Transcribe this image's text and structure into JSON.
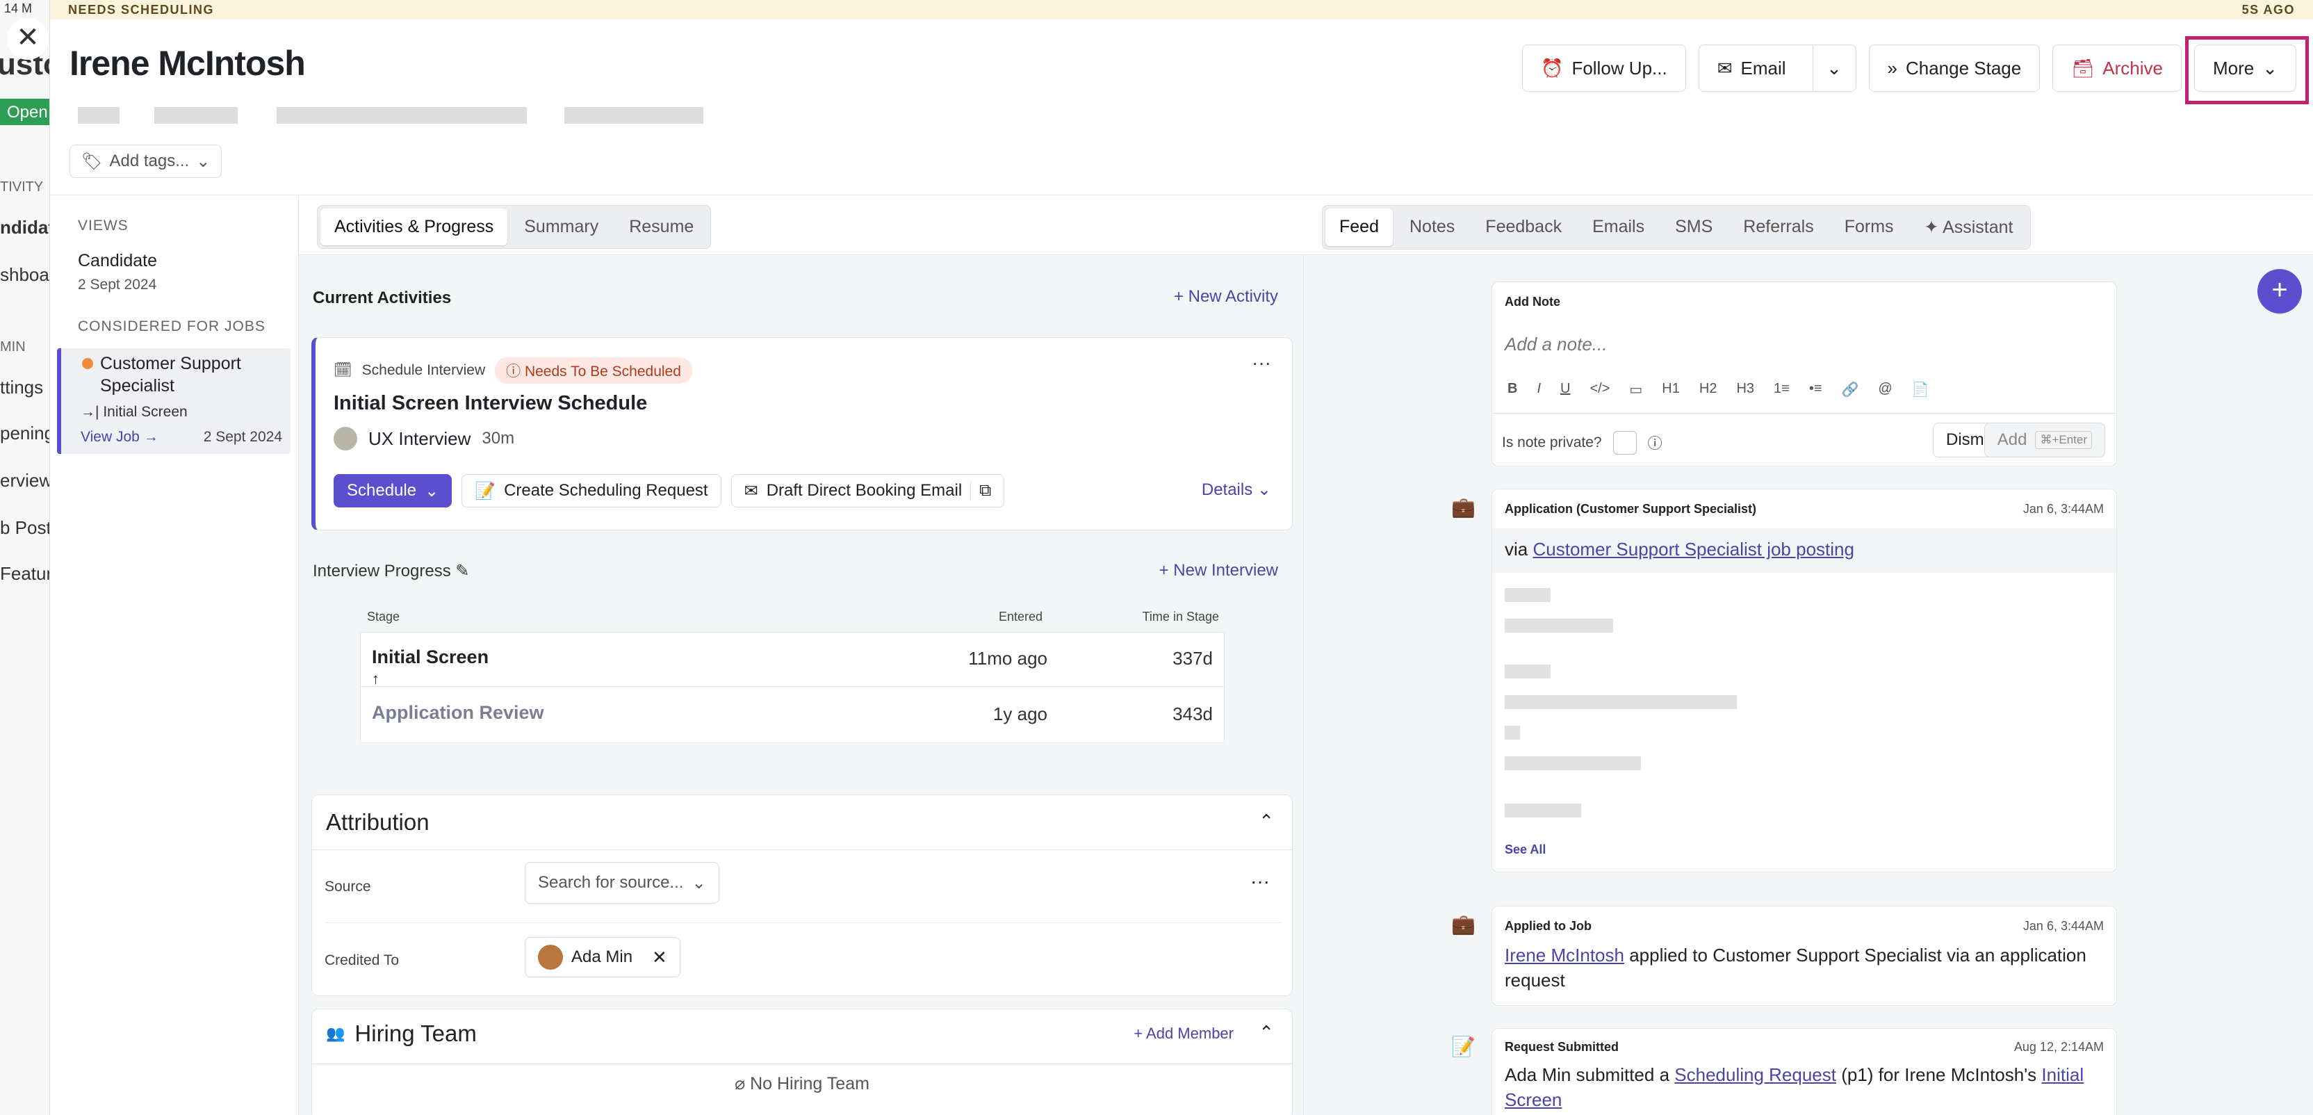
{
  "bg": {
    "lines": [
      "14 M",
      "usto",
      "Open",
      "TIVITY",
      "ndidat",
      "shboar",
      "MIN",
      "ttings",
      "penings",
      "erview",
      "b Posti",
      "Featur"
    ]
  },
  "banner": {
    "status": "NEEDS SCHEDULING",
    "time": "5S AGO"
  },
  "candidate": {
    "name": "Irene McIntosh",
    "tags_label": "Add tags..."
  },
  "actions": {
    "follow_up": "Follow Up...",
    "email": "Email",
    "change_stage": "Change Stage",
    "archive": "Archive",
    "more": "More"
  },
  "left": {
    "views_title": "VIEWS",
    "view_name": "Candidate",
    "view_date": "2 Sept 2024",
    "considered_title": "CONSIDERED FOR JOBS",
    "job_title": "Customer Support Specialist",
    "job_stage": "Initial Screen",
    "view_job": "View Job",
    "job_date": "2 Sept 2024"
  },
  "mid": {
    "tabs": [
      "Activities & Progress",
      "Summary",
      "Resume"
    ],
    "current_activities": "Current Activities",
    "new_activity": "New Activity",
    "activity": {
      "type": "Schedule Interview",
      "badge": "Needs To Be Scheduled",
      "title": "Initial Screen Interview Schedule",
      "interview": "UX Interview",
      "duration": "30m",
      "schedule": "Schedule",
      "create_request": "Create Scheduling Request",
      "draft_email": "Draft Direct Booking Email",
      "details": "Details"
    },
    "interview_progress": "Interview Progress",
    "new_interview": "New Interview",
    "progress": {
      "headers": [
        "Stage",
        "Entered",
        "Time in Stage"
      ],
      "rows": [
        {
          "stage": "Initial Screen",
          "entered": "11mo ago",
          "time": "337d"
        },
        {
          "stage": "Application Review",
          "entered": "1y ago",
          "time": "343d"
        }
      ]
    },
    "attribution": {
      "title": "Attribution",
      "source_label": "Source",
      "source_placeholder": "Search for source...",
      "credited_label": "Credited To",
      "credited_name": "Ada Min"
    },
    "hiring": {
      "title": "Hiring Team",
      "add_member": "Add Member",
      "empty": "No Hiring Team"
    }
  },
  "right": {
    "tabs": [
      "Feed",
      "Notes",
      "Feedback",
      "Emails",
      "SMS",
      "Referrals",
      "Forms",
      "Assistant"
    ],
    "note": {
      "title": "Add Note",
      "placeholder": "Add a note...",
      "toolbar": [
        "B",
        "I",
        "U",
        "</>",
        "▭",
        "H1",
        "H2",
        "H3",
        "1≡",
        "•≡",
        "🔗",
        "@",
        "📄"
      ],
      "private_label": "Is note private?",
      "dismiss": "Dismiss",
      "add": "Add",
      "shortcut": "⌘+Enter"
    },
    "feed": [
      {
        "title": "Application (Customer Support Specialist)",
        "date": "Jan 6, 3:44AM",
        "via": "via",
        "link": "Customer Support Specialist job posting",
        "see_all": "See All"
      },
      {
        "title": "Applied to Job",
        "date": "Jan 6, 3:44AM",
        "name": "Irene McIntosh",
        "mid": "applied to",
        "job": "Customer Support Specialist",
        "end": "via an application request"
      },
      {
        "title": "Request Submitted",
        "date": "Aug 12, 2:14AM",
        "who": "Ada Min",
        "t1": "submitted a",
        "link": "Scheduling Request",
        "t2": "(p1) for Irene McIntosh's",
        "link2": "Initial Screen"
      }
    ]
  }
}
